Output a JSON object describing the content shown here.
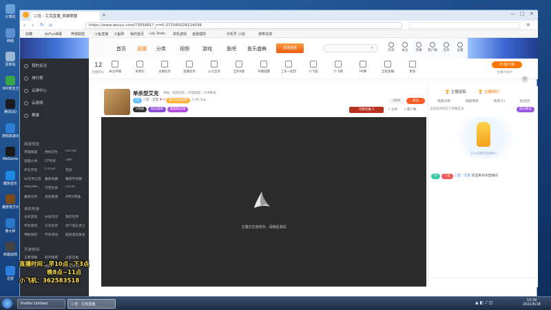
{
  "desktop": {
    "icons": [
      {
        "label": "计算机",
        "icon": "computer-icon",
        "color": "#6aa0d8"
      },
      {
        "label": "网络",
        "icon": "network-icon",
        "color": "#5b8fd0"
      },
      {
        "label": "回收站",
        "icon": "recycle-bin-icon",
        "color": "#9bb7d6"
      },
      {
        "label": "360安全卫士",
        "icon": "shield-icon",
        "color": "#38a54a"
      },
      {
        "label": "腾讯QQ",
        "icon": "qq-icon",
        "color": "#1c1c1c"
      },
      {
        "label": "搜狗高速浏览器",
        "icon": "browser-icon",
        "color": "#2d7fd6"
      },
      {
        "label": "WeGame",
        "icon": "wegame-icon",
        "color": "#1a1a1a"
      },
      {
        "label": "酷狗音乐",
        "icon": "music-icon",
        "color": "#1e88e5"
      },
      {
        "label": "魔兽官方对战平台",
        "icon": "game-icon",
        "color": "#7a4a1c"
      },
      {
        "label": "鲁大师",
        "icon": "tool-icon",
        "color": "#2b77c9"
      },
      {
        "label": "刺激战场",
        "icon": "game-icon",
        "color": "#444444"
      },
      {
        "label": "迅雷",
        "icon": "download-icon",
        "color": "#2e80e0"
      }
    ]
  },
  "browser": {
    "tab_title": "二佳 - 艾克直播_英雄联盟",
    "url": "https://www.douyu.com/7355881?_rr=0.371565028124036",
    "bookmarks": [
      "收藏",
      "AcFun弹幕",
      "奔驰联盟",
      "斗鱼直播",
      "斗鱼网",
      "我的首页",
      "LoL Stats",
      "单机游戏",
      "金融理财",
      "手机号 小说",
      "爆笑动漫"
    ]
  },
  "header": {
    "nav": [
      "首页",
      "直播",
      "分类",
      "视频",
      "游戏",
      "鱼吧",
      "鱼乐盛典"
    ],
    "active_nav": "直播",
    "promo": "现场观看",
    "search_placeholder": "",
    "user_icons": [
      "历史",
      "关注",
      "开播",
      "客户端",
      "任务",
      "设置"
    ]
  },
  "sidebar": {
    "top_items": [
      "我的关注",
      "排行榜",
      "云游中心",
      "云游戏",
      "赛事"
    ],
    "sections": [
      {
        "title": "网游竞技",
        "items": [
          "英雄联盟",
          "绝地求生",
          "DOTA2",
          "穿越火线",
          "CF手游",
          "DNF",
          "炉石传说",
          "CS:GO",
          "逆战",
          "lol云顶之弈",
          "魔兽争霸",
          "魔兽怀旧服",
          "VALORA...",
          "守望先锋",
          "DOTA",
          "魔兽世界",
          "其他网游",
          "APEX英雄"
        ]
      },
      {
        "title": "单机热游",
        "items": [
          "主机游戏",
          "永劫无间",
          "我的世界",
          "怀旧游戏",
          "方舟生存",
          "地下城与勇士",
          "神秘探险",
          "怀旧游戏",
          "超级游戏集合"
        ]
      },
      {
        "title": "手游休闲",
        "items": [
          "王者荣耀",
          "和平精英",
          "火影忍者",
          "LOL手游",
          "原神",
          "COD手游"
        ]
      }
    ],
    "icons": [
      "heart-icon",
      "rank-icon",
      "cloud-icon",
      "gamepad-icon",
      "trophy-icon"
    ]
  },
  "toolbar": {
    "rank_label": "12",
    "rank_sub": "主播积分",
    "items": [
      "关注开播",
      "表情包",
      "主播任务",
      "直播任务",
      "火力全开",
      "全民K歌",
      "开播提醒",
      "上车一起玩",
      "小飞船",
      "小飞碟",
      "PK赛",
      "全民直播",
      "更多"
    ],
    "pc_button": "PC客户端",
    "pc_sub": "主播PK助手"
  },
  "room": {
    "title": "单杀型艾克",
    "breadcrumbs": [
      "举报",
      "网游竞技",
      "英雄联盟",
      "大神解说"
    ],
    "streamer": "二佳 - 艾克",
    "likes": "0",
    "tag": "官方认证主播",
    "hot": "45.5kg",
    "level_badge": "V等级",
    "medal": "粉丝勋章",
    "rank_badge": "超级粉丝榜",
    "viewers": "2884",
    "follow": "关注",
    "watch_count": "可预次数",
    "watch_num": "2",
    "share": "分享",
    "report": "客户端"
  },
  "video": {
    "status": "主播正在连线中，请稍后测试"
  },
  "chat": {
    "tabs": [
      "主播投稿",
      "主播排行"
    ],
    "subtabs": [
      "贡献日榜",
      "贡献周榜",
      "贵宾(1)",
      "粉丝团"
    ],
    "notice": "当前房间开启了弹幕互动",
    "notice2": "成为粉丝",
    "mascot_caption": "这么安静的直播间~",
    "message_badge": "二佳",
    "message_user": "二佳 - 艾克",
    "message_text": "欢迎来到本直播间"
  },
  "overlay": {
    "line1": "直播时间：早10点~下3点",
    "line2": "晚8点~11点",
    "line3": "小飞机：362583518"
  },
  "taskbar": {
    "apps": [
      "Profiler Untitled",
      "二佳 - 艾克直播_"
    ],
    "time": "10:39",
    "date": "2021/6/18"
  },
  "colors": {
    "accent": "#ff7700",
    "follow": "#ff5d23",
    "video_bg": "#2b2b2b",
    "sidebar_bg": "#2a2d33"
  }
}
